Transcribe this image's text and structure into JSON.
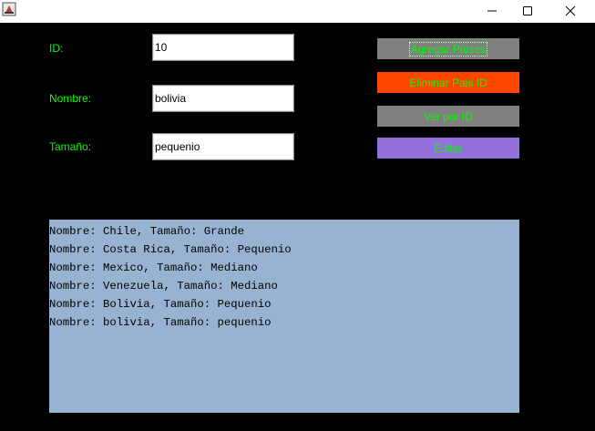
{
  "window": {
    "min_icon": "minimize-icon",
    "max_icon": "maximize-icon",
    "close_icon": "close-icon",
    "app_icon": "java-app-icon"
  },
  "form": {
    "id_label": "ID:",
    "id_value": "10",
    "nombre_label": "Nombre:",
    "nombre_value": "bolivia",
    "tamano_label": "Tamaño:",
    "tamano_value": "pequenio"
  },
  "buttons": {
    "agregar": "Agregar Paises",
    "eliminar": "Eliminar Pais ID",
    "ver": "Ver por ID",
    "editar": "Editar"
  },
  "colors": {
    "background": "#000000",
    "label_text": "#00ff00",
    "btn_gray": "#808080",
    "btn_orange": "#ff4500",
    "btn_purple": "#9370db",
    "output_bg": "#97b3d1"
  },
  "output": {
    "lines": [
      "Nombre: Chile, Tamaño: Grande",
      "Nombre: Costa Rica, Tamaño: Pequenio",
      "Nombre: Mexico, Tamaño: Mediano",
      "Nombre: Venezuela, Tamaño: Mediano",
      "Nombre: Bolivia, Tamaño: Pequenio",
      "Nombre: bolivia, Tamaño: pequenio"
    ]
  }
}
